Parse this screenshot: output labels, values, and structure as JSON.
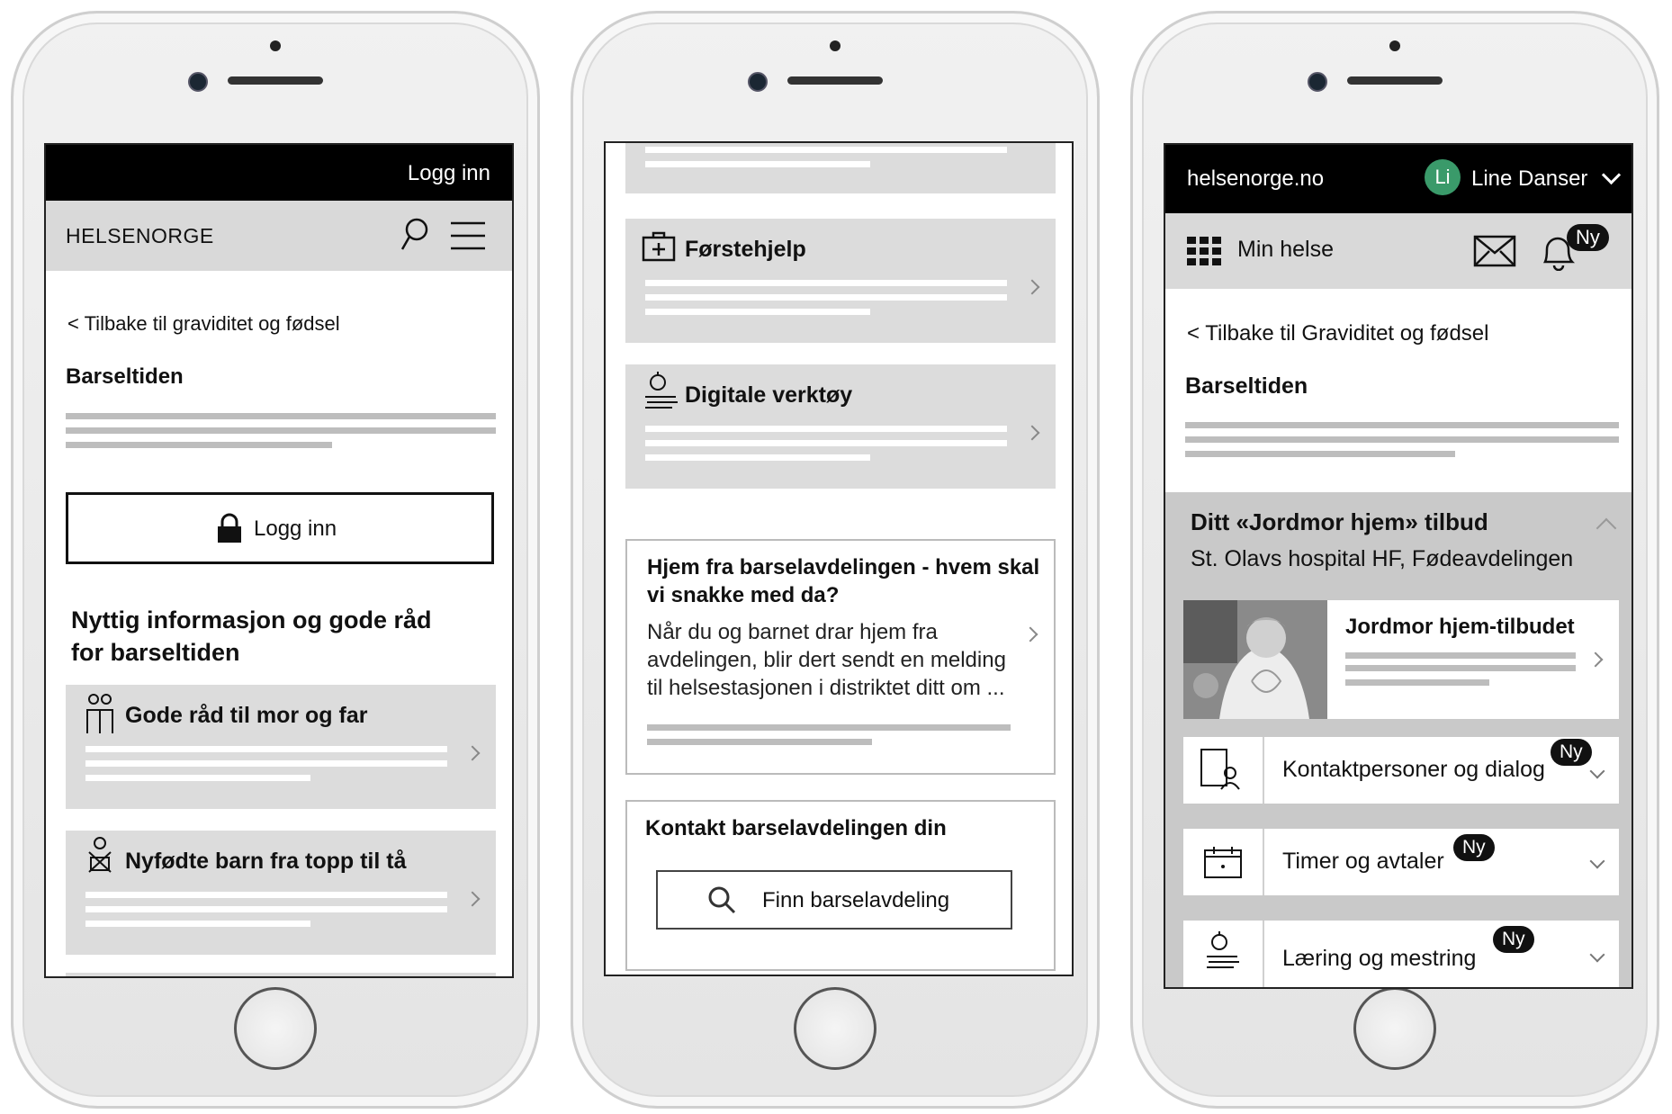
{
  "phone1": {
    "topbar_login": "Logg inn",
    "brand": "HELSENORGE",
    "back_link": "< Tilbake til graviditet og fødsel",
    "title": "Barseltiden",
    "login_button": "Logg inn",
    "section_heading_line1": "Nyttig informasjon og gode råd",
    "section_heading_line2": "for barseltiden",
    "cards": [
      {
        "label": "Gode råd til mor og far",
        "icon": "parents-icon"
      },
      {
        "label": "Nyfødte barn fra topp til tå",
        "icon": "baby-icon"
      }
    ]
  },
  "phone2": {
    "cards": [
      {
        "label": "Førstehjelp",
        "icon": "first-aid-icon"
      },
      {
        "label": "Digitale verktøy",
        "icon": "digital-tools-icon"
      }
    ],
    "article": {
      "title_line1": "Hjem fra barselavdelingen - hvem skal",
      "title_line2": "vi snakke med da?",
      "body_line1": "Når du og barnet drar hjem fra",
      "body_line2": "avdelingen, blir dert sendt en melding",
      "body_line3": "til helsestasjonen i distriktet ditt om ..."
    },
    "contact": {
      "heading": "Kontakt barselavdelingen din",
      "button": "Finn barselavdeling"
    }
  },
  "phone3": {
    "site": "helsenorge.no",
    "avatar_initials": "Li",
    "user_name": "Line Danser",
    "menu_label": "Min helse",
    "bell_badge": "Ny",
    "back_link": "< Tilbake til Graviditet og fødsel",
    "title": "Barseltiden",
    "offer_title": "Ditt «Jordmor hjem» tilbud",
    "offer_subtitle": "St. Olavs hospital HF, Fødeavdelingen",
    "offer_card_title": "Jordmor hjem-tilbudet",
    "rows": [
      {
        "label": "Kontaktpersoner og dialog",
        "badge": "Ny",
        "icon": "contact-person-icon"
      },
      {
        "label": "Timer og avtaler",
        "badge": "Ny",
        "icon": "calendar-icon"
      },
      {
        "label": "Læring og mestring",
        "badge": "Ny",
        "icon": "learning-icon"
      }
    ],
    "avatar_color": "#3a9a6a"
  }
}
